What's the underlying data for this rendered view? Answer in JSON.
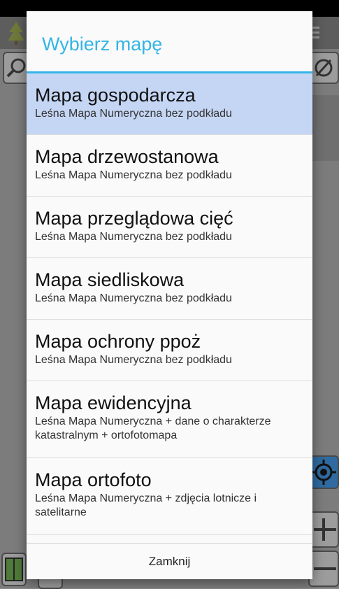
{
  "dialog": {
    "title": "Wybierz mapę",
    "close_label": "Zamknij",
    "items": [
      {
        "title": "Mapa gospodarcza",
        "subtitle": "Leśna Mapa Numeryczna bez podkładu",
        "selected": true
      },
      {
        "title": "Mapa drzewostanowa",
        "subtitle": "Leśna Mapa Numeryczna bez podkładu"
      },
      {
        "title": "Mapa przeglądowa cięć",
        "subtitle": "Leśna Mapa Numeryczna bez podkładu"
      },
      {
        "title": "Mapa siedliskowa",
        "subtitle": "Leśna Mapa Numeryczna bez podkładu"
      },
      {
        "title": "Mapa ochrony ppoż",
        "subtitle": "Leśna Mapa Numeryczna bez podkładu"
      },
      {
        "title": "Mapa ewidencyjna",
        "subtitle": "Leśna Mapa Numeryczna +  dane o charakterze katastralnym + ortofotomapa"
      },
      {
        "title": "Mapa ortofoto",
        "subtitle": "Leśna Mapa Numeryczna + zdjęcia lotnicze i satelitarne"
      }
    ]
  },
  "colors": {
    "accent": "#33b5e5",
    "selected_bg": "#c5d6f5"
  },
  "background_icons": [
    "tree-logo-icon",
    "menu-icon",
    "search-icon",
    "compass-icon",
    "gps-target-icon",
    "zoom-in-icon",
    "zoom-out-icon",
    "book-map-icon"
  ]
}
